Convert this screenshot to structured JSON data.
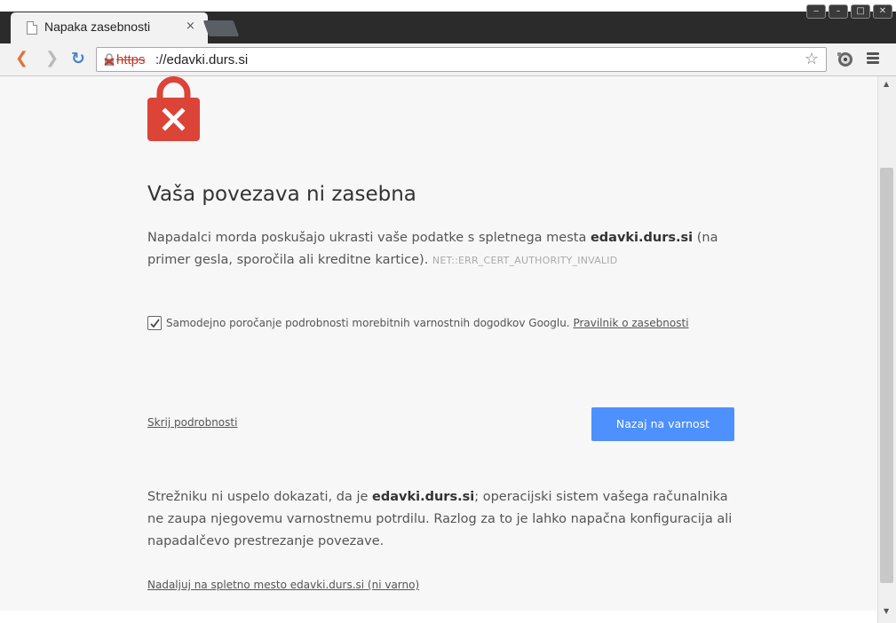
{
  "window": {
    "controls": [
      "‒",
      "–",
      "□",
      "✕"
    ]
  },
  "tab": {
    "title": "Napaka zasebnosti",
    "close": "×"
  },
  "toolbar": {
    "back": "❮",
    "forward": "❯",
    "reload": "↻",
    "url_scheme": "https",
    "url_rest": "://edavki.durs.si",
    "bookmark": "☆"
  },
  "page": {
    "heading": "Vaša povezava ni zasebna",
    "intro_before": "Napadalci morda poskušajo ukrasti vaše podatke s spletnega mesta ",
    "intro_domain": "edavki.durs.si",
    "intro_after": " (na primer gesla, sporočila ali kreditne kartice). ",
    "error_code": "NET::ERR_CERT_AUTHORITY_INVALID",
    "report_text": "Samodejno poročanje podrobnosti morebitnih varnostnih dogodkov Googlu. ",
    "report_checked": true,
    "privacy_link": "Pravilnik o zasebnosti",
    "hide_details": "Skrij podrobnosti",
    "back_to_safety": "Nazaj na varnost",
    "details_before": "Strežniku ni uspelo dokazati, da je ",
    "details_domain": "edavki.durs.si",
    "details_after": "; operacijski sistem vašega računalnika ne zaupa njegovemu varnostnemu potrdilu. Razlog za to je lahko napačna konfiguracija ali napadalčevo prestrezanje povezave.",
    "proceed_link": "Nadaljuj na spletno mesto edavki.durs.si (ni varno)"
  },
  "colors": {
    "accent_button": "#4d90fe",
    "lock_red": "#db4437",
    "page_bg": "#f7f7f7"
  },
  "icons": {
    "tab": "page-icon",
    "lock": "broken-lock-icon",
    "extension": "extension-icon",
    "menu": "hamburger-menu-icon"
  }
}
